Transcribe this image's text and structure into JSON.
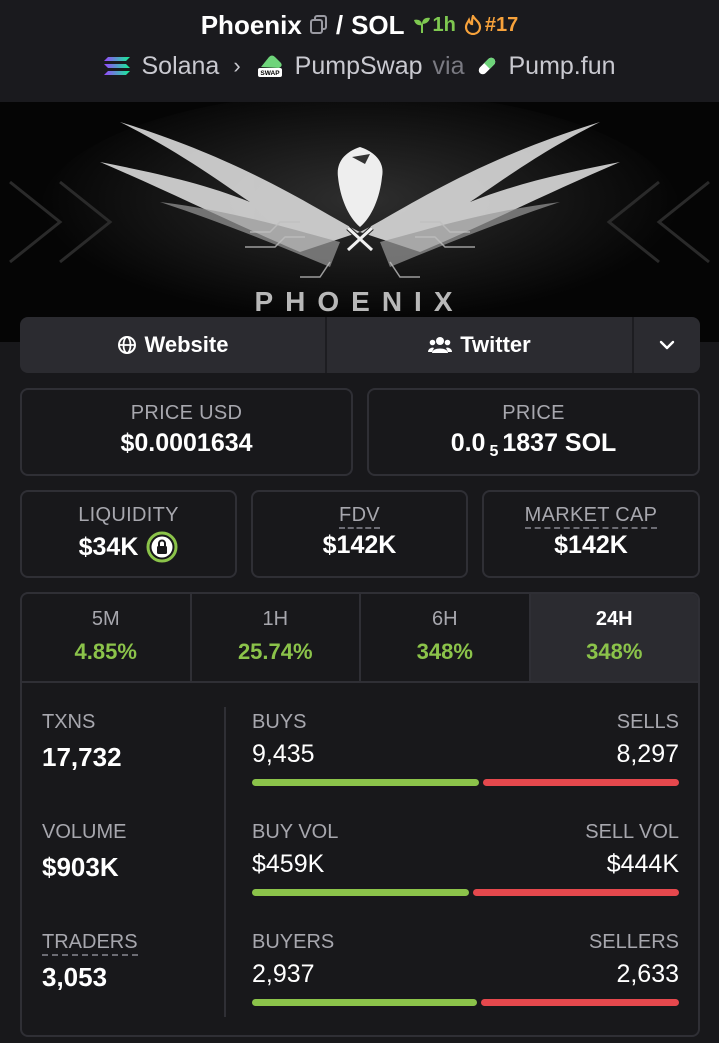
{
  "header": {
    "token": "Phoenix",
    "separator": "/",
    "quote": "SOL",
    "age": "1h",
    "rank": "#17",
    "chain": "Solana",
    "dex": "PumpSwap",
    "via": "via",
    "launchpad": "Pump.fun"
  },
  "banner": {
    "text": "PHOENIX"
  },
  "links": {
    "website": "Website",
    "twitter": "Twitter"
  },
  "prices": {
    "usd_label": "PRICE USD",
    "usd_value": "$0.0001634",
    "native_label": "PRICE",
    "native_prefix": "0.0",
    "native_zeros": "5",
    "native_digits": "1837 SOL"
  },
  "metrics": {
    "liquidity_label": "LIQUIDITY",
    "liquidity_value": "$34K",
    "fdv_label": "FDV",
    "fdv_value": "$142K",
    "mcap_label": "MARKET CAP",
    "mcap_value": "$142K"
  },
  "periods": [
    {
      "label": "5M",
      "change": "4.85%"
    },
    {
      "label": "1H",
      "change": "25.74%"
    },
    {
      "label": "6H",
      "change": "348%"
    },
    {
      "label": "24H",
      "change": "348%",
      "active": true
    }
  ],
  "stats": {
    "txns_label": "TXNS",
    "txns_value": "17,732",
    "volume_label": "VOLUME",
    "volume_value": "$903K",
    "traders_label": "TRADERS",
    "traders_value": "3,053",
    "buys_label": "BUYS",
    "buys_value": "9,435",
    "sells_label": "SELLS",
    "sells_value": "8,297",
    "buyvol_label": "BUY VOL",
    "buyvol_value": "$459K",
    "sellvol_label": "SELL VOL",
    "sellvol_value": "$444K",
    "buyers_label": "BUYERS",
    "buyers_value": "2,937",
    "sellers_label": "SELLERS",
    "sellers_value": "2,633"
  },
  "bar_ratios": {
    "txns": 0.532,
    "volume": 0.508,
    "makers": 0.527
  },
  "colors": {
    "green": "#8bc34a",
    "red": "#e5484d",
    "age": "#7ec850",
    "rank": "#f7a23b"
  }
}
